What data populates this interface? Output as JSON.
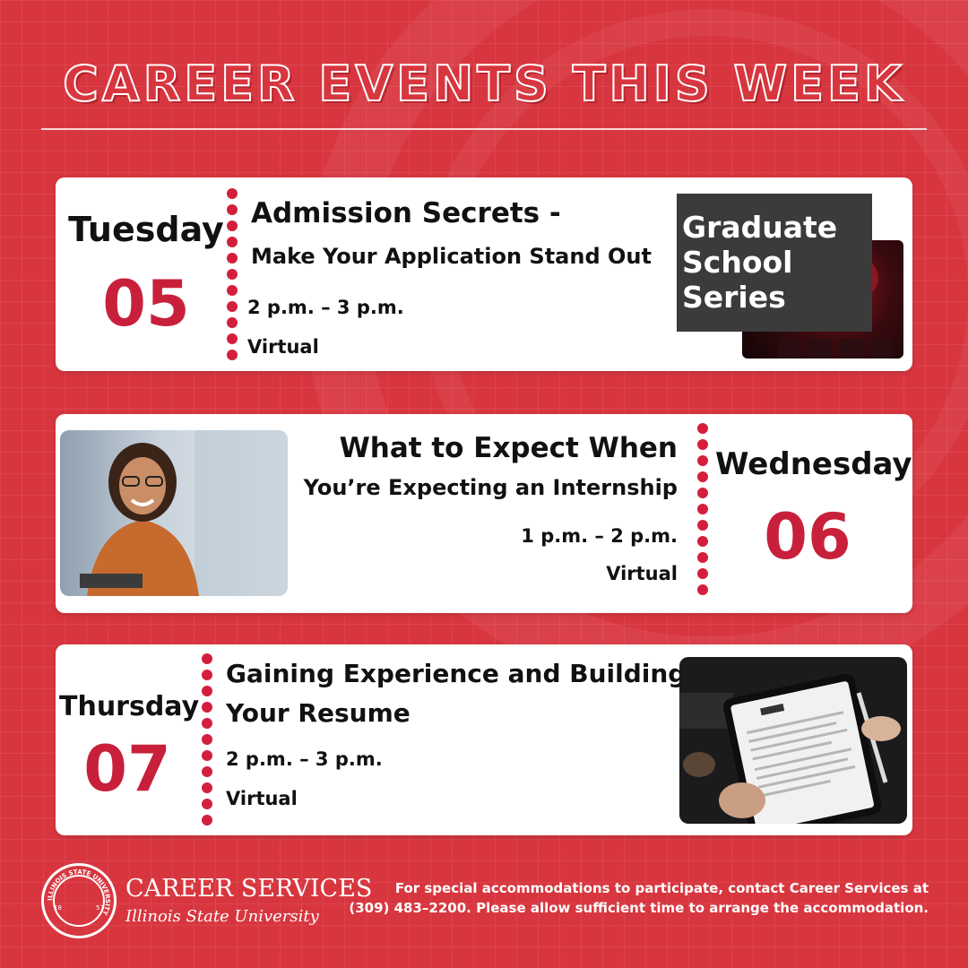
{
  "colors": {
    "background": "#d8363f",
    "accent": "#c8203b",
    "card": "#ffffff",
    "dark_box": "#3b3b3b"
  },
  "header": {
    "title": "CAREER EVENTS THIS WEEK"
  },
  "events": [
    {
      "day": "Tuesday",
      "date": "05",
      "title": "Admission Secrets -",
      "subtitle": "Make Your Application Stand Out",
      "time": "2 p.m. –  3 p.m.",
      "location": "Virtual",
      "badge": "Graduate School Series"
    },
    {
      "day": "Wednesday",
      "date": "06",
      "title": "What to Expect When",
      "subtitle": "You’re Expecting an Internship",
      "time": "1 p.m. – 2 p.m.",
      "location": "Virtual"
    },
    {
      "day": "Thursday",
      "date": "07",
      "title": "Gaining Experience and Building",
      "subtitle": "Your Resume",
      "time": "2 p.m. – 3 p.m.",
      "location": "Virtual"
    }
  ],
  "footer": {
    "brand_line1": "CAREER SERVICES",
    "brand_line2": "Illinois State University",
    "seal_name": "ILLINOIS STATE UNIVERSITY",
    "seal_years": [
      "18",
      "57"
    ],
    "notice_line1": "For special accommodations to participate, contact Career Services at",
    "notice_line2": "(309) 483–2200. Please allow sufficient time to arrange the accommodation."
  },
  "icons": [
    "seal-logo-icon",
    "student-photo",
    "resume-tablet-photo",
    "theater-photo"
  ]
}
